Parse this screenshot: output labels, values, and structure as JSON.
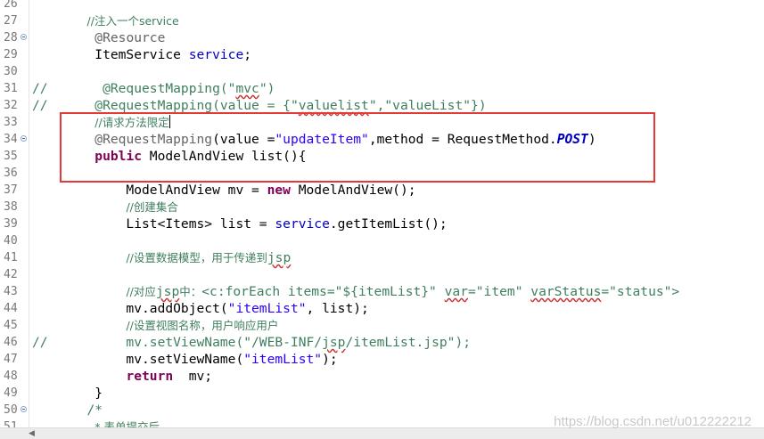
{
  "editor": {
    "lines": [
      {
        "n": "26",
        "fold": false,
        "tokens": []
      },
      {
        "n": "27",
        "fold": false,
        "tokens": [
          {
            "t": "       "
          },
          {
            "t": "//注入一个service",
            "c": "cc"
          }
        ]
      },
      {
        "n": "28",
        "fold": true,
        "tokens": [
          {
            "t": "        "
          },
          {
            "t": "@Resource",
            "c": "a"
          }
        ]
      },
      {
        "n": "29",
        "fold": false,
        "tokens": [
          {
            "t": "        ItemService "
          },
          {
            "t": "service",
            "c": "f"
          },
          {
            "t": ";"
          }
        ]
      },
      {
        "n": "30",
        "fold": false,
        "tokens": []
      },
      {
        "n": "31",
        "fold": false,
        "tokens": [
          {
            "t": "//       @RequestMapping(\"",
            "c": "c"
          },
          {
            "t": "mvc",
            "c": "c u"
          },
          {
            "t": "\")",
            "c": "c"
          }
        ]
      },
      {
        "n": "32",
        "fold": false,
        "tokens": [
          {
            "t": "//      @RequestMapping(value = {\"",
            "c": "c"
          },
          {
            "t": "valuelist",
            "c": "c u"
          },
          {
            "t": "\",\"valueList\"})",
            "c": "c"
          }
        ]
      },
      {
        "n": "33",
        "fold": false,
        "tokens": [
          {
            "t": "        "
          },
          {
            "t": "//请求方法限定",
            "c": "cc"
          },
          {
            "t": "",
            "c": "caret"
          }
        ]
      },
      {
        "n": "34",
        "fold": true,
        "tokens": [
          {
            "t": "        "
          },
          {
            "t": "@RequestMapping",
            "c": "a"
          },
          {
            "t": "(value ="
          },
          {
            "t": "\"updateItem\"",
            "c": "s"
          },
          {
            "t": ",method = RequestMethod."
          },
          {
            "t": "POST",
            "c": "sf"
          },
          {
            "t": ")"
          }
        ]
      },
      {
        "n": "35",
        "fold": false,
        "tokens": [
          {
            "t": "        "
          },
          {
            "t": "public",
            "c": "k"
          },
          {
            "t": " ModelAndView list(){"
          }
        ]
      },
      {
        "n": "36",
        "fold": false,
        "tokens": []
      },
      {
        "n": "37",
        "fold": false,
        "tokens": [
          {
            "t": "            ModelAndView mv = "
          },
          {
            "t": "new",
            "c": "k"
          },
          {
            "t": " ModelAndView();"
          }
        ]
      },
      {
        "n": "38",
        "fold": false,
        "tokens": [
          {
            "t": "            "
          },
          {
            "t": "//创建集合",
            "c": "cc"
          }
        ]
      },
      {
        "n": "39",
        "fold": false,
        "tokens": [
          {
            "t": "            List<Items> list = "
          },
          {
            "t": "service",
            "c": "f"
          },
          {
            "t": ".getItemList();"
          }
        ]
      },
      {
        "n": "40",
        "fold": false,
        "tokens": []
      },
      {
        "n": "41",
        "fold": false,
        "tokens": [
          {
            "t": "            "
          },
          {
            "t": "//设置数据模型，用于传递到",
            "c": "cc"
          },
          {
            "t": "jsp",
            "c": "c u"
          }
        ]
      },
      {
        "n": "42",
        "fold": false,
        "tokens": []
      },
      {
        "n": "43",
        "fold": false,
        "tokens": [
          {
            "t": "            "
          },
          {
            "t": "//对应",
            "c": "cc"
          },
          {
            "t": "jsp",
            "c": "c u"
          },
          {
            "t": "中：",
            "c": "cc"
          },
          {
            "t": "<c:forEach items=\"${itemList}\" ",
            "c": "c"
          },
          {
            "t": "var",
            "c": "c u"
          },
          {
            "t": "=\"item\" ",
            "c": "c"
          },
          {
            "t": "varStatus",
            "c": "c u"
          },
          {
            "t": "=\"status\">",
            "c": "c"
          }
        ]
      },
      {
        "n": "44",
        "fold": false,
        "tokens": [
          {
            "t": "            mv.addObject("
          },
          {
            "t": "\"itemList\"",
            "c": "s"
          },
          {
            "t": ", list);"
          }
        ]
      },
      {
        "n": "45",
        "fold": false,
        "tokens": [
          {
            "t": "            "
          },
          {
            "t": "//设置视图名称，用户响应用户",
            "c": "cc"
          }
        ]
      },
      {
        "n": "46",
        "fold": false,
        "tokens": [
          {
            "t": "//          mv.setViewName(\"/WEB-INF/",
            "c": "c"
          },
          {
            "t": "jsp",
            "c": "c u"
          },
          {
            "t": "/itemList.jsp\");",
            "c": "c"
          }
        ]
      },
      {
        "n": "47",
        "fold": false,
        "tokens": [
          {
            "t": "            mv.setViewName("
          },
          {
            "t": "\"itemList\"",
            "c": "s"
          },
          {
            "t": ");"
          }
        ]
      },
      {
        "n": "48",
        "fold": false,
        "tokens": [
          {
            "t": "            "
          },
          {
            "t": "return",
            "c": "k"
          },
          {
            "t": "  mv;"
          }
        ]
      },
      {
        "n": "49",
        "fold": false,
        "tokens": [
          {
            "t": "        }"
          }
        ]
      },
      {
        "n": "50",
        "fold": true,
        "tokens": [
          {
            "t": "       "
          },
          {
            "t": "/*",
            "c": "c"
          }
        ]
      },
      {
        "n": "51",
        "fold": false,
        "tokens": [
          {
            "t": "        "
          },
          {
            "t": "* 表单提交后",
            "c": "cc"
          }
        ]
      }
    ]
  },
  "scrollbar": {
    "left_arrow": "◀"
  },
  "watermark": "https://blog.csdn.net/u012222212",
  "colors": {
    "keyword": "#7f0055",
    "string": "#2a00ff",
    "comment": "#3f7f5f",
    "annotation": "#646464",
    "field": "#0000c0",
    "highlight_box": "#e53935"
  }
}
